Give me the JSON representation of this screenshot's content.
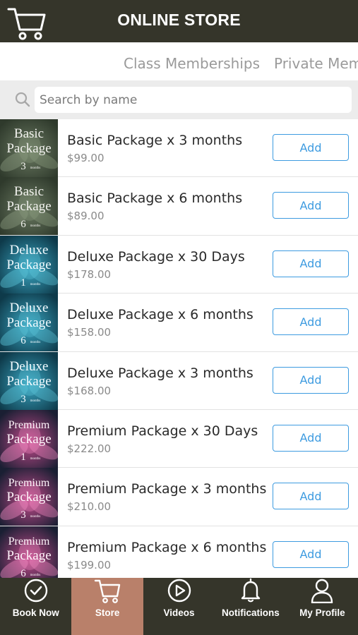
{
  "header": {
    "title": "ONLINE STORE",
    "icon": "cart-icon"
  },
  "tabs": [
    {
      "label": "Class Memberships"
    },
    {
      "label": "Private Memb"
    }
  ],
  "search": {
    "placeholder": "Search by name",
    "value": ""
  },
  "products": [
    {
      "name": "Basic Package x 3 months",
      "price": "$99.00",
      "button": "Add",
      "thumb_line1": "Basic",
      "thumb_line2": "Package",
      "thumb_line3": "3",
      "thumb_line4": "months",
      "theme": "green"
    },
    {
      "name": "Basic Package x 6 months",
      "price": "$89.00",
      "button": "Add",
      "thumb_line1": "Basic",
      "thumb_line2": "Package",
      "thumb_line3": "6",
      "thumb_line4": "months",
      "theme": "green"
    },
    {
      "name": "Deluxe Package x 30 Days",
      "price": "$178.00",
      "button": "Add",
      "thumb_line1": "Deluxe",
      "thumb_line2": "Package",
      "thumb_line3": "1",
      "thumb_line4": "months",
      "theme": "blue"
    },
    {
      "name": "Deluxe Package x 6 months",
      "price": "$158.00",
      "button": "Add",
      "thumb_line1": "Deluxe",
      "thumb_line2": "Package",
      "thumb_line3": "6",
      "thumb_line4": "months",
      "theme": "blue"
    },
    {
      "name": "Deluxe Package x 3 months",
      "price": "$168.00",
      "button": "Add",
      "thumb_line1": "Deluxe",
      "thumb_line2": "Package",
      "thumb_line3": "3",
      "thumb_line4": "months",
      "theme": "blue"
    },
    {
      "name": "Premium Package x 30 Days",
      "price": "$222.00",
      "button": "Add",
      "thumb_line1": "Premium",
      "thumb_line2": "Package",
      "thumb_line3": "1",
      "thumb_line4": "months",
      "theme": "pink"
    },
    {
      "name": "Premium Package x 3 months",
      "price": "$210.00",
      "button": "Add",
      "thumb_line1": "Premium",
      "thumb_line2": "Package",
      "thumb_line3": "3",
      "thumb_line4": "months",
      "theme": "pink"
    },
    {
      "name": "Premium Package x 6 months",
      "price": "$199.00",
      "button": "Add",
      "thumb_line1": "Premium",
      "thumb_line2": "Package",
      "thumb_line3": "6",
      "thumb_line4": "months",
      "theme": "pink"
    }
  ],
  "nav": [
    {
      "label": "Book Now",
      "icon": "check-circle-icon",
      "active": false
    },
    {
      "label": "Store",
      "icon": "cart-icon",
      "active": true
    },
    {
      "label": "Videos",
      "icon": "play-circle-icon",
      "active": false
    },
    {
      "label": "Notifications",
      "icon": "bell-icon",
      "active": false
    },
    {
      "label": "My Profile",
      "icon": "user-icon",
      "active": false
    }
  ],
  "colors": {
    "header_bg": "#35352a",
    "accent_blue": "#3d9be0",
    "nav_active": "#b9806a",
    "search_bg": "#ececec"
  }
}
